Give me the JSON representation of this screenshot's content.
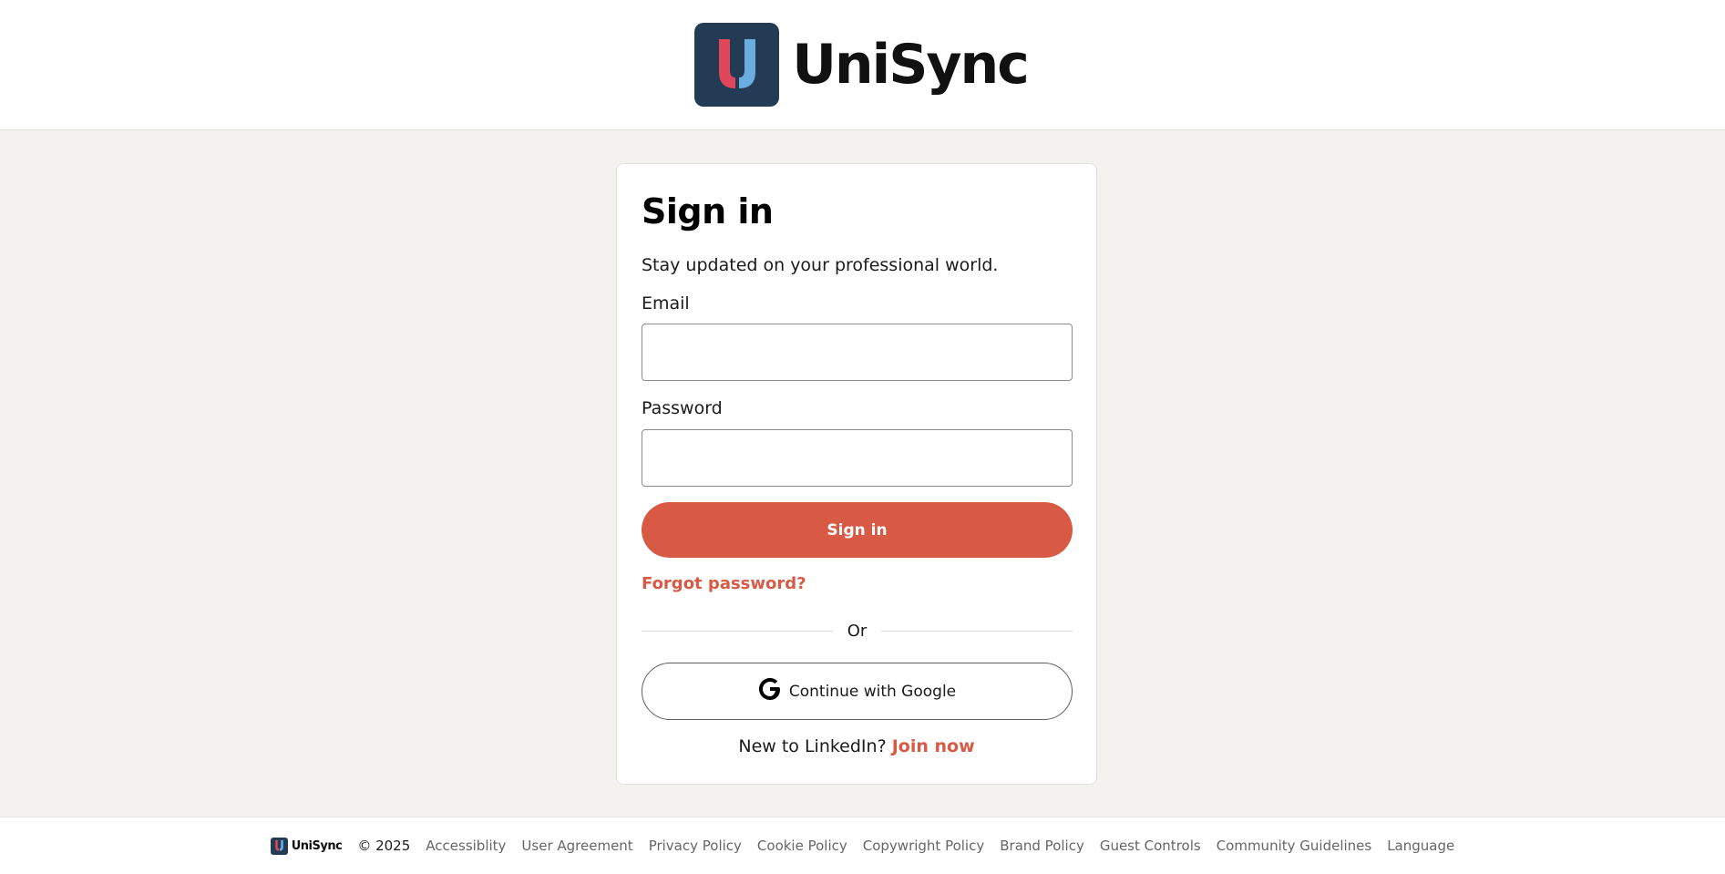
{
  "header": {
    "brand_name": "UniSync",
    "logo_icon": "unisync-logo-icon"
  },
  "signin": {
    "title": "Sign in",
    "subtitle": "Stay updated on your professional world.",
    "email_label": "Email",
    "email_value": "",
    "password_label": "Password",
    "password_value": "",
    "submit_label": "Sign in",
    "forgot_label": "Forgot password?",
    "divider_label": "Or",
    "google_label": "Continue with Google",
    "google_icon": "google-icon",
    "join_prompt": "New to LinkedIn?",
    "join_label": "Join now"
  },
  "footer": {
    "brand_name": "UniSync",
    "copyright": "© 2025",
    "links": [
      "Accessiblity",
      "User Agreement",
      "Privacy Policy",
      "Cookie Policy",
      "Copywright Policy",
      "Brand Policy",
      "Guest Controls",
      "Community Guidelines",
      "Language"
    ]
  },
  "colors": {
    "accent": "#d85a45",
    "logo_bg": "#243b55",
    "logo_red": "#e0475a",
    "logo_blue": "#6aaee0",
    "page_bg": "#f3f2ef"
  }
}
